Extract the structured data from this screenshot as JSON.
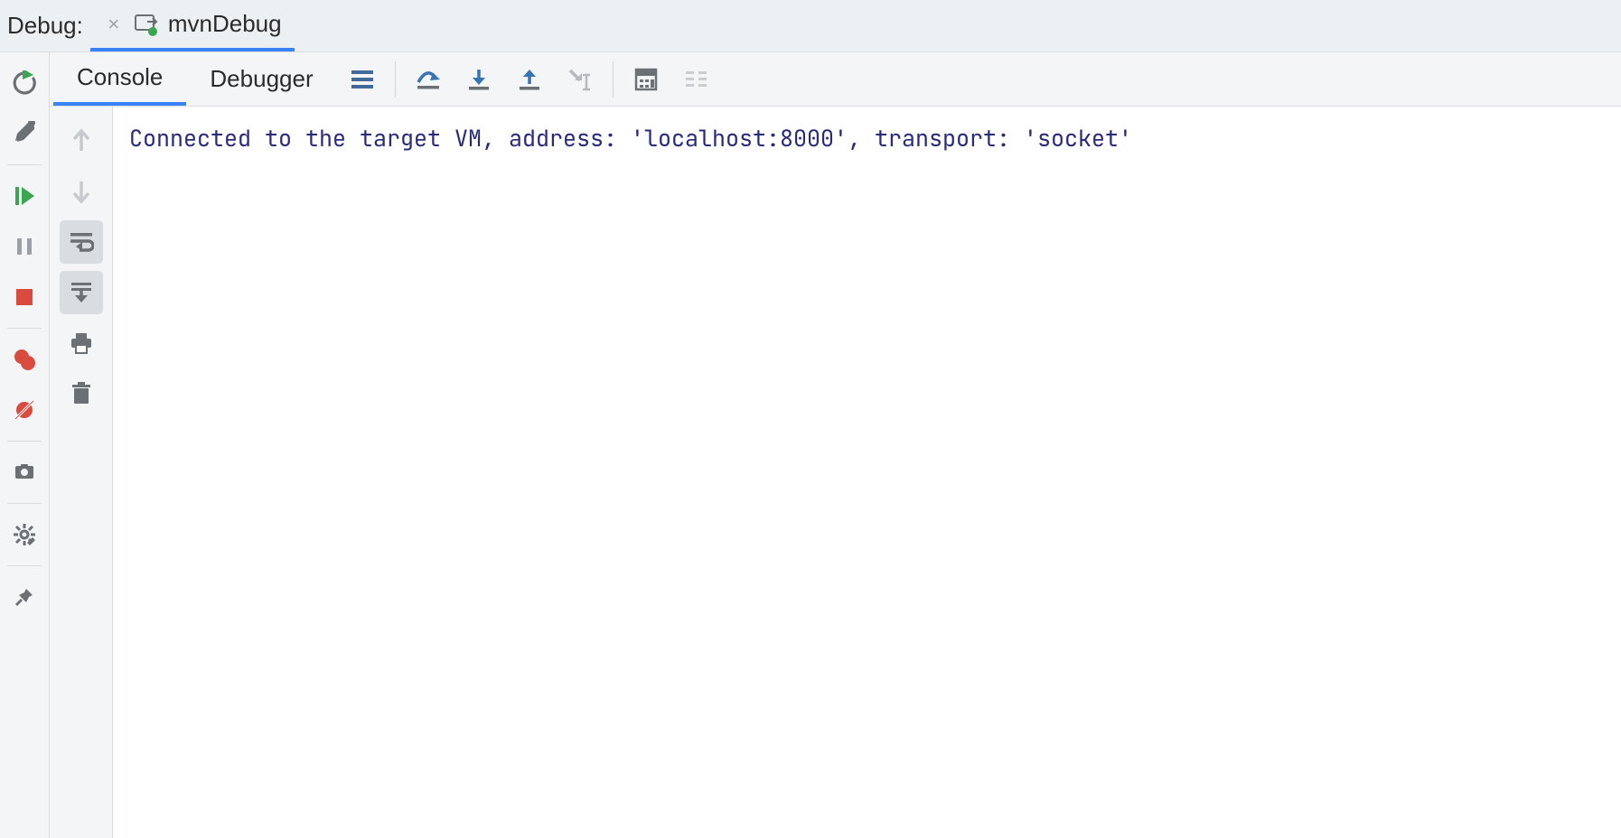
{
  "panel": {
    "title": "Debug:"
  },
  "tabs": [
    {
      "label": "mvnDebug",
      "active": true
    }
  ],
  "subTabs": {
    "console": "Console",
    "debugger": "Debugger"
  },
  "console": {
    "line1": "Connected to the target VM, address: 'localhost:8000', transport: 'socket'"
  },
  "icons": {
    "rerun": "rerun",
    "settings_wrench": "wrench",
    "resume": "resume",
    "pause": "pause",
    "stop": "stop",
    "breakpoints": "breakpoints",
    "mute_bp": "mute-breakpoints",
    "camera": "camera",
    "gear": "gear",
    "pin": "pin",
    "up": "up",
    "down": "down",
    "softwrap": "soft-wrap",
    "scroll_end": "scroll-to-end",
    "print": "print",
    "trash": "trash",
    "threads": "threads",
    "step_over": "step-over",
    "step_into": "step-into",
    "step_out": "step-out",
    "run_to_cursor": "run-to-cursor",
    "evaluate": "evaluate-expression",
    "trace": "trace"
  }
}
